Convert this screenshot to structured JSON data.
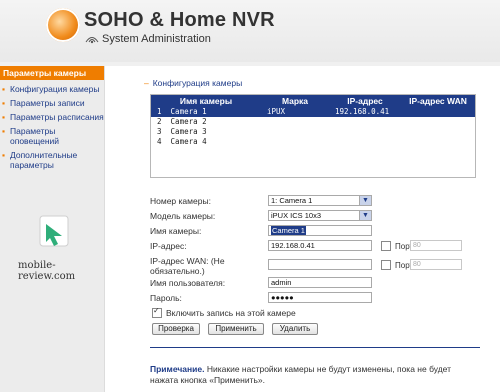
{
  "header": {
    "title": "SOHO & Home NVR",
    "subtitle": "System Administration"
  },
  "sidebar": {
    "heading": "Параметры камеры",
    "items": [
      {
        "label": "Конфигурация камеры"
      },
      {
        "label": "Параметры записи"
      },
      {
        "label": "Параметры расписания"
      },
      {
        "label": "Параметры оповещений"
      },
      {
        "label": "Дополнительные параметры"
      }
    ],
    "watermark": "mobile-review.com"
  },
  "section": {
    "title": "Конфигурация камеры"
  },
  "table": {
    "headers": [
      "Имя камеры",
      "Марка",
      "IP-адрес",
      "IP-адрес WAN"
    ],
    "rows": [
      {
        "num": "1",
        "name": "Camera 1",
        "brand": "iPUX",
        "ip": "192.168.0.41",
        "wan": "",
        "selected": true
      },
      {
        "num": "2",
        "name": "Camera 2",
        "brand": "",
        "ip": "",
        "wan": "",
        "selected": false
      },
      {
        "num": "3",
        "name": "Camera 3",
        "brand": "",
        "ip": "",
        "wan": "",
        "selected": false
      },
      {
        "num": "4",
        "name": "Camera 4",
        "brand": "",
        "ip": "",
        "wan": "",
        "selected": false
      }
    ]
  },
  "form": {
    "camera_number": {
      "label": "Номер камеры:",
      "value": "1: Camera 1"
    },
    "camera_model": {
      "label": "Модель камеры:",
      "value": "iPUX ICS 10x3"
    },
    "camera_name": {
      "label": "Имя камеры:",
      "value": "Camera 1"
    },
    "ip_address": {
      "label": "IP-адрес:",
      "value": "192.168.0.41",
      "port_label": "Порт",
      "port_value": "80"
    },
    "wan_address": {
      "label": "IP-адрес WAN: (Не обязательно.)",
      "value": "",
      "port_label": "Порт",
      "port_value": "80"
    },
    "username": {
      "label": "Имя пользователя:",
      "value": "admin"
    },
    "password": {
      "label": "Пароль:",
      "value": "●●●●●"
    },
    "record_checkbox": {
      "label": "Включить запись на этой камере",
      "checked": true
    }
  },
  "buttons": {
    "check": "Проверка",
    "apply": "Применить",
    "delete": "Удалить"
  },
  "note": {
    "heading": "Примечание.",
    "text": "Никакие настройки камеры не будут изменены, пока не будет нажата кнопка «Применить»."
  },
  "colors": {
    "accent": "#ef7d00",
    "primary": "#1f3c88"
  }
}
